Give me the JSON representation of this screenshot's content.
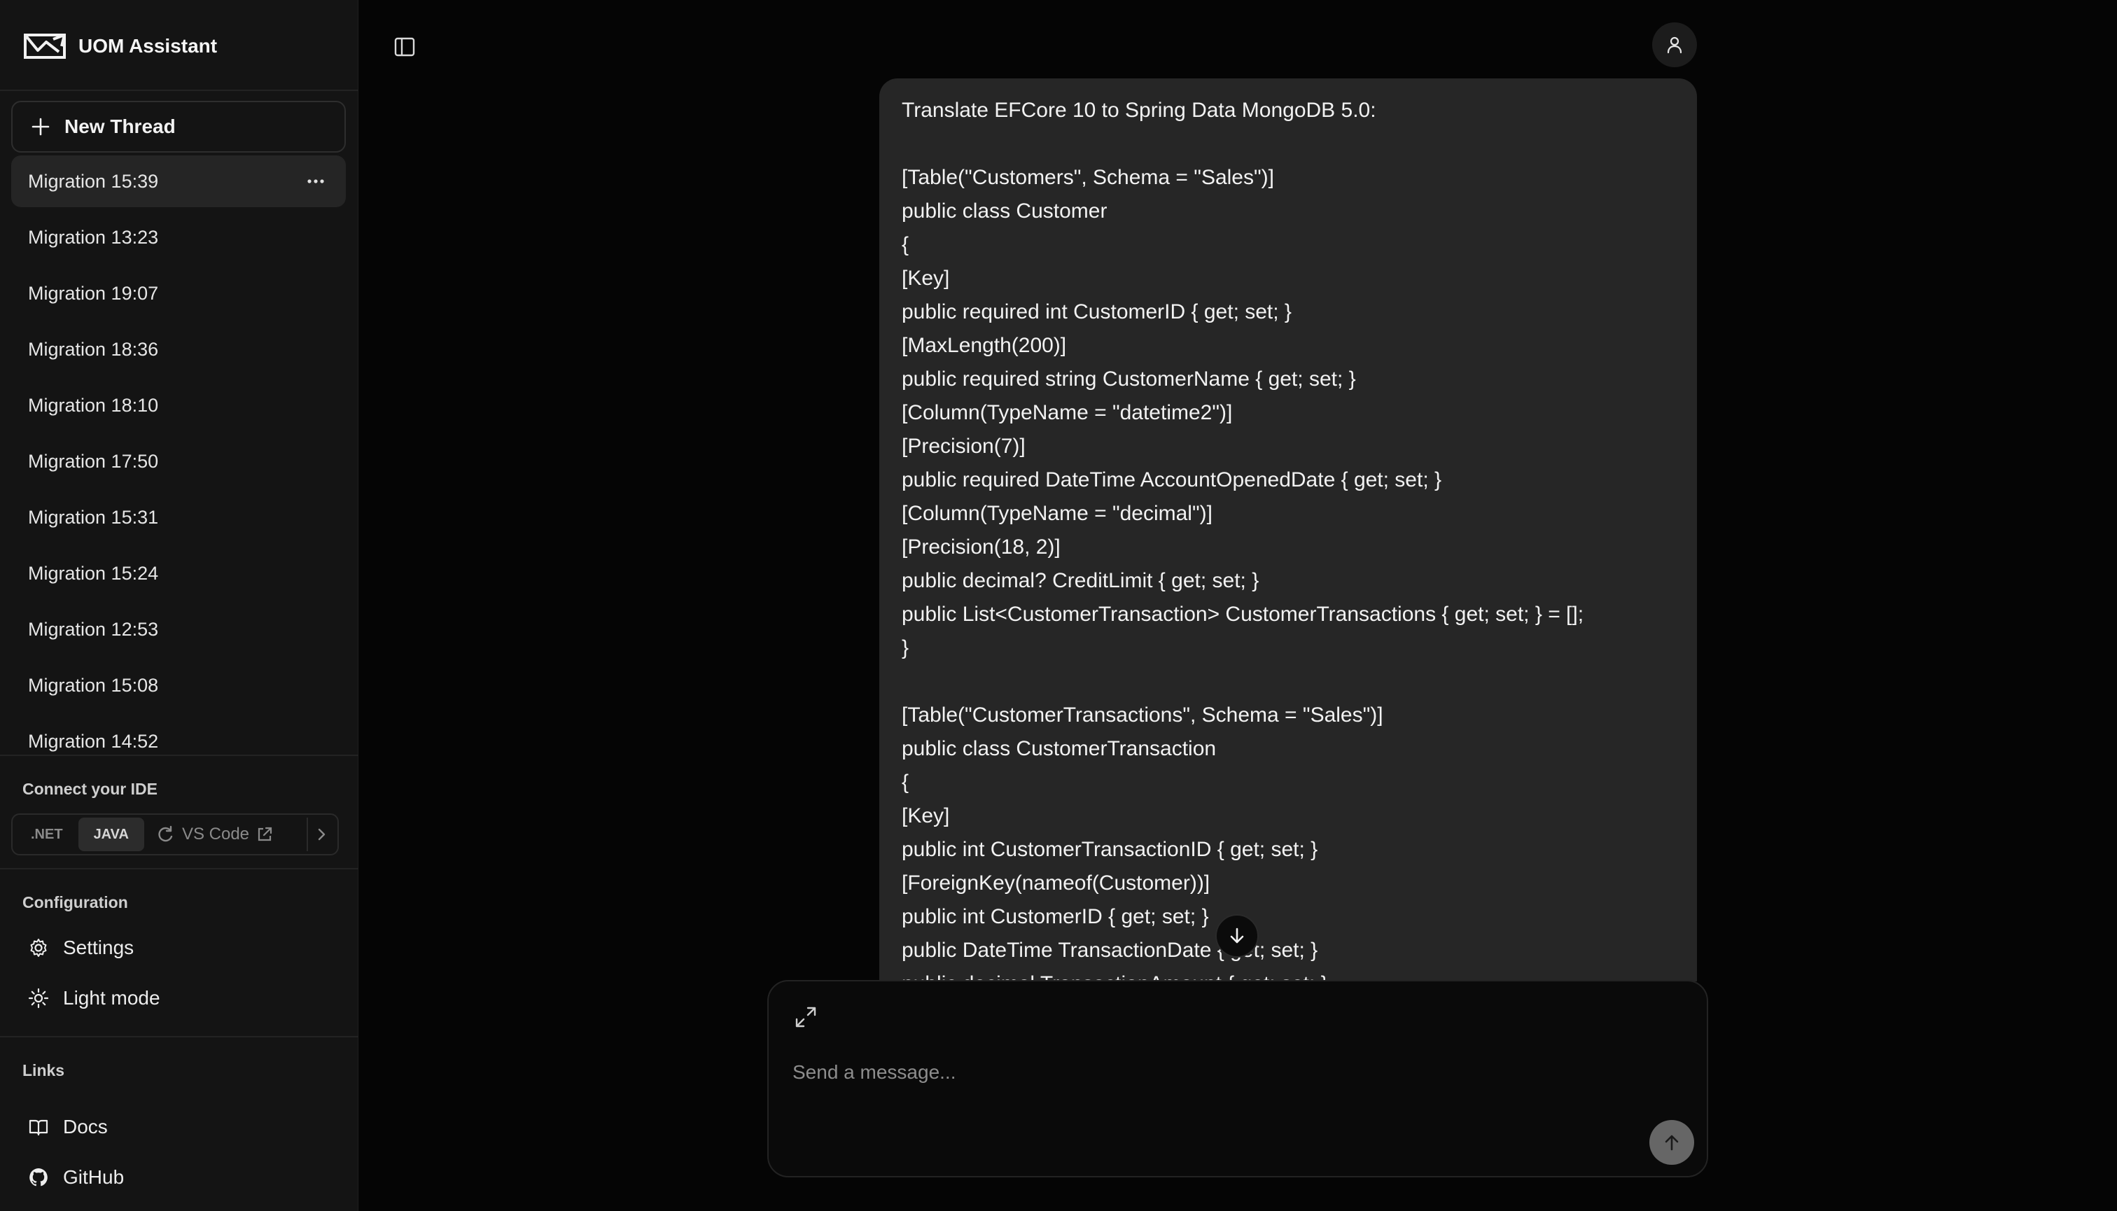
{
  "app": {
    "title": "UOM Assistant"
  },
  "sidebar": {
    "new_thread_label": "New Thread",
    "threads": [
      {
        "label": "Migration 15:39",
        "active": true
      },
      {
        "label": "Migration 13:23"
      },
      {
        "label": "Migration 19:07"
      },
      {
        "label": "Migration 18:36"
      },
      {
        "label": "Migration 18:10"
      },
      {
        "label": "Migration 17:50"
      },
      {
        "label": "Migration 15:31"
      },
      {
        "label": "Migration 15:24"
      },
      {
        "label": "Migration 12:53"
      },
      {
        "label": "Migration 15:08"
      },
      {
        "label": "Migration 14:52"
      }
    ],
    "ide": {
      "heading": "Connect your IDE",
      "options": [
        ".NET",
        "JAVA"
      ],
      "selected": "JAVA",
      "vscode_label": "VS Code"
    },
    "configuration": {
      "heading": "Configuration",
      "settings_label": "Settings",
      "theme_label": "Light mode"
    },
    "links": {
      "heading": "Links",
      "docs_label": "Docs",
      "github_label": "GitHub"
    }
  },
  "chat": {
    "message": "Translate EFCore 10 to Spring Data MongoDB 5.0:\n\n[Table(\"Customers\", Schema = \"Sales\")]\npublic class Customer\n{\n[Key]\npublic required int CustomerID { get; set; }\n[MaxLength(200)]\npublic required string CustomerName { get; set; }\n[Column(TypeName = \"datetime2\")]\n[Precision(7)]\npublic required DateTime AccountOpenedDate { get; set; }\n[Column(TypeName = \"decimal\")]\n[Precision(18, 2)]\npublic decimal? CreditLimit { get; set; }\npublic List<CustomerTransaction> CustomerTransactions { get; set; } = [];\n}\n\n[Table(\"CustomerTransactions\", Schema = \"Sales\")]\npublic class CustomerTransaction\n{\n[Key]\npublic int CustomerTransactionID { get; set; }\n[ForeignKey(nameof(Customer))]\npublic int CustomerID { get; set; }\npublic DateTime TransactionDate { get; set; }\npublic decimal TransactionAmount { get; set; }"
  },
  "composer": {
    "placeholder": "Send a message..."
  }
}
